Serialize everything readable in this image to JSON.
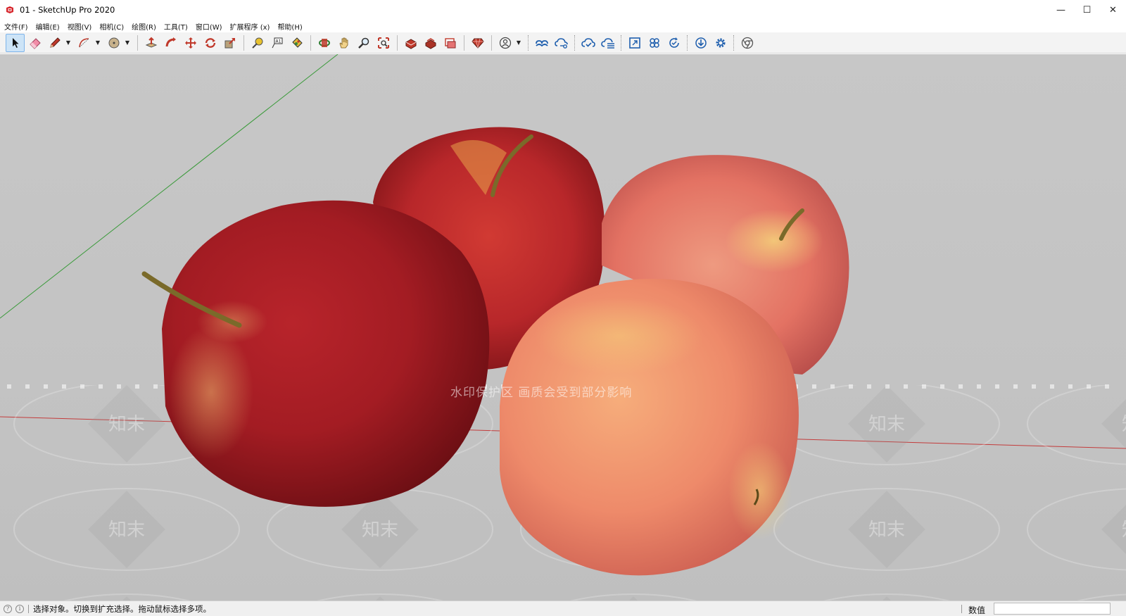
{
  "window": {
    "title": "01 - SketchUp Pro 2020",
    "minimize": "—",
    "maximize": "☐",
    "close": "✕"
  },
  "menu": [
    {
      "label": "文件(F)"
    },
    {
      "label": "编辑(E)"
    },
    {
      "label": "视图(V)"
    },
    {
      "label": "相机(C)"
    },
    {
      "label": "绘图(R)"
    },
    {
      "label": "工具(T)"
    },
    {
      "label": "窗口(W)"
    },
    {
      "label": "扩展程序 (x)"
    },
    {
      "label": "帮助(H)"
    }
  ],
  "toolbar": {
    "active_tool": "select",
    "accent": "#7eb4ea"
  },
  "viewport": {
    "watermark": "水印保护区   画质会受到部分影响",
    "tile_text": "知末",
    "background": "#c4c4c4",
    "axis_red": "#c33b3b",
    "axis_green": "#3a9a3a"
  },
  "status": {
    "message": "选择对象。切换到扩充选择。拖动鼠标选择多项。",
    "measure_label": "数值",
    "measure_value": ""
  }
}
